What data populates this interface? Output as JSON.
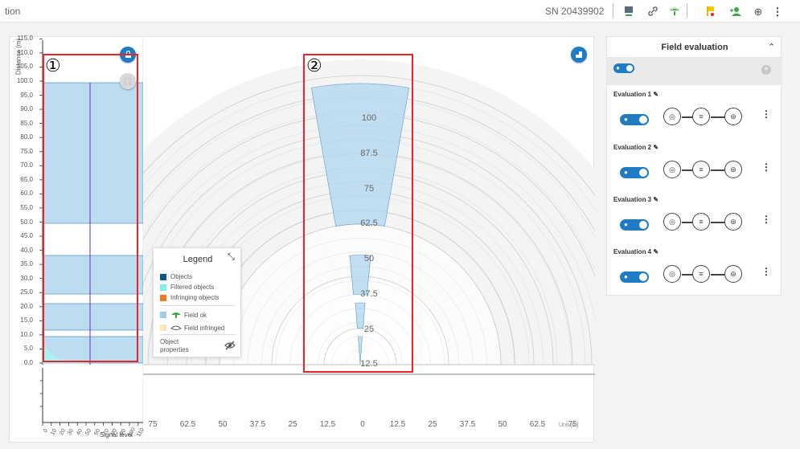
{
  "topbar": {
    "title": "tion",
    "serial": "SN 20439902"
  },
  "icons": [
    "monitor-icon",
    "link-icon",
    "sensor-ok-icon",
    "alert-flag-icon",
    "add-user-icon",
    "globe-icon",
    "more-vert-icon"
  ],
  "annotations": {
    "one": "①",
    "two": "②"
  },
  "left_chart": {
    "ylabel": "Distance (m)",
    "yticks": [
      "115.0",
      "110.0",
      "105.0",
      "100.0",
      "95.0",
      "90.0",
      "85.0",
      "80.0",
      "75.0",
      "70.0",
      "65.0",
      "60.0",
      "55.0",
      "50.0",
      "45.0",
      "40.0",
      "35.0",
      "30.0",
      "25.0",
      "20.0",
      "15.0",
      "10.0",
      "5.0",
      "0.0"
    ],
    "signal_ticks": [
      "0",
      "10",
      "20",
      "30",
      "40",
      "50",
      "60",
      "70",
      "80",
      "90",
      "100",
      "110"
    ],
    "signal_label": "Signal level"
  },
  "radar": {
    "range_labels": [
      "100",
      "87.5",
      "75",
      "62.5",
      "50",
      "37.5",
      "25",
      "12.5"
    ],
    "x_ticks": [
      "75",
      "62.5",
      "50",
      "37.5",
      "25",
      "12.5",
      "0",
      "12.5",
      "25",
      "37.5",
      "50",
      "62.5",
      "75"
    ],
    "unit": "Unit [m]"
  },
  "legend": {
    "title": "Legend",
    "objects": "Objects",
    "filtered": "Filtered objects",
    "infringing": "Infringing objects",
    "field_ok": "Field ok",
    "field_infringed": "Field infringed",
    "object_props": "Object properties"
  },
  "side": {
    "header": "Field evaluation",
    "evaluations": [
      {
        "label": "Evaluation 1"
      },
      {
        "label": "Evaluation 2"
      },
      {
        "label": "Evaluation 3"
      },
      {
        "label": "Evaluation 4"
      }
    ]
  },
  "colors": {
    "field": "#bcdcf0",
    "field_line": "#4a90c2",
    "accent": "#1f7cc4",
    "annotation": "#e8242a"
  }
}
